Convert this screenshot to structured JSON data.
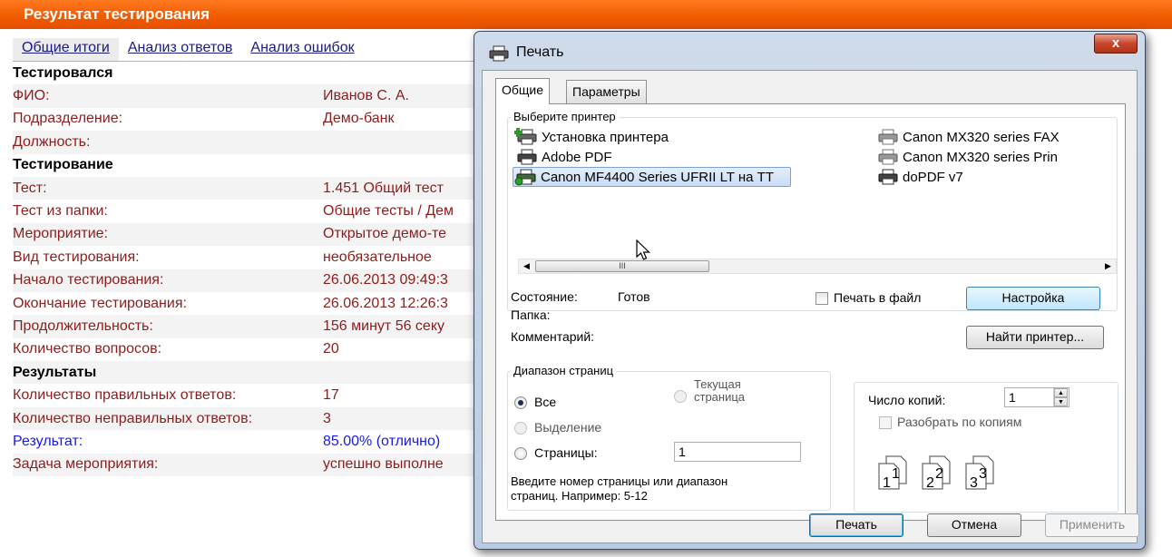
{
  "page": {
    "header_title": "Результат тестирования",
    "tabs": [
      {
        "label": "Общие итоги"
      },
      {
        "label": "Анализ ответов"
      },
      {
        "label": "Анализ ошибок"
      }
    ],
    "rows": [
      {
        "label": "Тестировался",
        "value": "",
        "type": "section"
      },
      {
        "label": "ФИО:",
        "value": "Иванов С. А."
      },
      {
        "label": "Подразделение:",
        "value": "Демо-банк"
      },
      {
        "label": "Должность:",
        "value": ""
      },
      {
        "label": "Тестирование",
        "value": "",
        "type": "section"
      },
      {
        "label": "Тест:",
        "value": "1.451 Общий тест"
      },
      {
        "label": "Тест из папки:",
        "value": "Общие тесты / Дем"
      },
      {
        "label": "Мероприятие:",
        "value": "Открытое демо-те"
      },
      {
        "label": "Вид тестирования:",
        "value": "необязательное"
      },
      {
        "label": "Начало тестирования:",
        "value": "26.06.2013 09:49:3"
      },
      {
        "label": "Окончание тестирования:",
        "value": "26.06.2013 12:26:3"
      },
      {
        "label": "Продолжительность:",
        "value": "156 минут 56 секу"
      },
      {
        "label": "Количество вопросов:",
        "value": "20"
      },
      {
        "label": "Результаты",
        "value": "",
        "type": "section"
      },
      {
        "label": "Количество правильных ответов:",
        "value": "17"
      },
      {
        "label": "Количество неправильных ответов:",
        "value": "3"
      },
      {
        "label": "Результат:",
        "value": "85.00% (отлично)",
        "type": "blue"
      },
      {
        "label": "Задача мероприятия:",
        "value": "успешно выполне"
      }
    ]
  },
  "dialog": {
    "title": "Печать",
    "close_label": "x",
    "tabs": {
      "general": "Общие",
      "parameters": "Параметры"
    },
    "printer_group_label": "Выберите принтер",
    "printers": [
      {
        "label": "Установка принтера",
        "icon": "add-printer-icon"
      },
      {
        "label": "Adobe PDF",
        "icon": "printer-icon"
      },
      {
        "label": "Canon MF4400 Series UFRII LT на TT",
        "icon": "default-printer-icon",
        "selected": true
      },
      {
        "label": "Canon MX320 series FAX",
        "icon": "printer-icon"
      },
      {
        "label": "Canon MX320 series Prin",
        "icon": "printer-icon"
      },
      {
        "label": "doPDF v7",
        "icon": "printer-icon"
      }
    ],
    "scroll_thumb_grip": "III",
    "status_label": "Состояние:",
    "status_value": "Готов",
    "folder_label": "Папка:",
    "comment_label": "Комментарий:",
    "print_to_file_label": "Печать в файл",
    "settings_button": "Настройка",
    "find_printer_button": "Найти принтер...",
    "page_range": {
      "group_label": "Диапазон страниц",
      "all_label": "Все",
      "current_page_label_1": "Текущая",
      "current_page_label_2": "страница",
      "selection_label": "Выделение",
      "pages_label": "Страницы:",
      "pages_value": "1",
      "hint_line1": "Введите номер страницы или диапазон",
      "hint_line2": "страниц.  Например: 5-12"
    },
    "copies": {
      "label": "Число копий:",
      "value": "1",
      "collate_label": "Разобрать по копиям",
      "collate_icons": [
        "1",
        "1",
        "2",
        "2",
        "3",
        "3"
      ]
    },
    "buttons": {
      "print": "Печать",
      "cancel": "Отмена",
      "apply": "Применить"
    }
  }
}
